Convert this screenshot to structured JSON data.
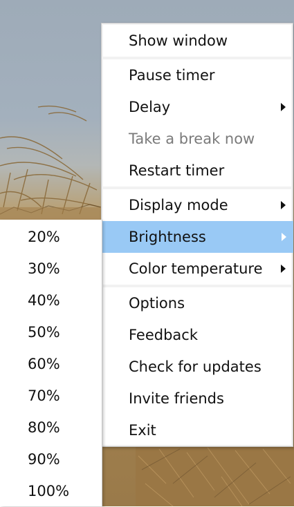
{
  "menu": {
    "items": [
      {
        "label": "Show window"
      },
      {
        "label": "Pause timer"
      },
      {
        "label": "Delay"
      },
      {
        "label": "Take a break now"
      },
      {
        "label": "Restart timer"
      },
      {
        "label": "Display mode"
      },
      {
        "label": "Brightness"
      },
      {
        "label": "Color temperature"
      },
      {
        "label": "Options"
      },
      {
        "label": "Feedback"
      },
      {
        "label": "Check for updates"
      },
      {
        "label": "Invite friends"
      },
      {
        "label": "Exit"
      }
    ]
  },
  "brightness_submenu": {
    "options": [
      "20%",
      "30%",
      "40%",
      "50%",
      "60%",
      "70%",
      "80%",
      "90%",
      "100%"
    ]
  },
  "colors": {
    "highlight": "#99c9f5",
    "disabled_text": "#7a7a7a",
    "menu_background": "#ffffff",
    "separator": "#f2f2f2"
  },
  "icons": {
    "submenu_arrow": "chevron-right-icon"
  }
}
